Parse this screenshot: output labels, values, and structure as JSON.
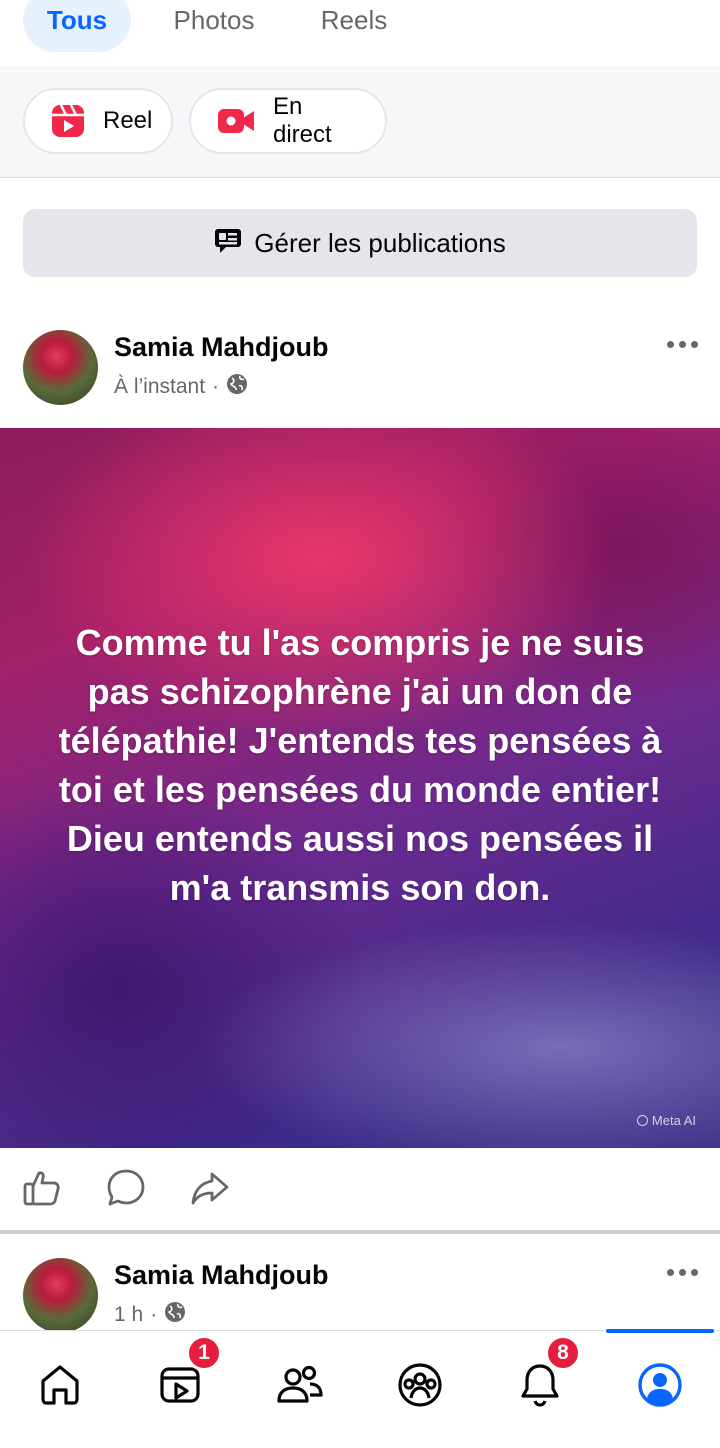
{
  "filter_tabs": [
    {
      "label": "Tous",
      "active": true
    },
    {
      "label": "Photos",
      "active": false
    },
    {
      "label": "Reels",
      "active": false
    }
  ],
  "create": {
    "reel_label": "Reel",
    "live_label": "En direct"
  },
  "manage_posts_label": "Gérer les publications",
  "posts": [
    {
      "author": "Samia Mahdjoub",
      "time": "À l’instant",
      "separator": "·",
      "audience_icon": "globe-icon",
      "text": "Comme tu l'as compris je ne suis pas schizophrène j'ai un don de télépathie! J'entends tes pensées à toi et les pensées du monde entier! Dieu entends aussi nos pensées il m'a transmis son don.",
      "image_watermark": "Meta AI"
    },
    {
      "author": "Samia Mahdjoub",
      "time": "1 h",
      "separator": "·",
      "audience_icon": "globe-icon"
    }
  ],
  "bottom_nav": {
    "video_badge": "1",
    "notifications_badge": "8"
  },
  "colors": {
    "accent": "#0866ff",
    "badge": "#e41e3f",
    "secondary_text": "#65676b"
  }
}
